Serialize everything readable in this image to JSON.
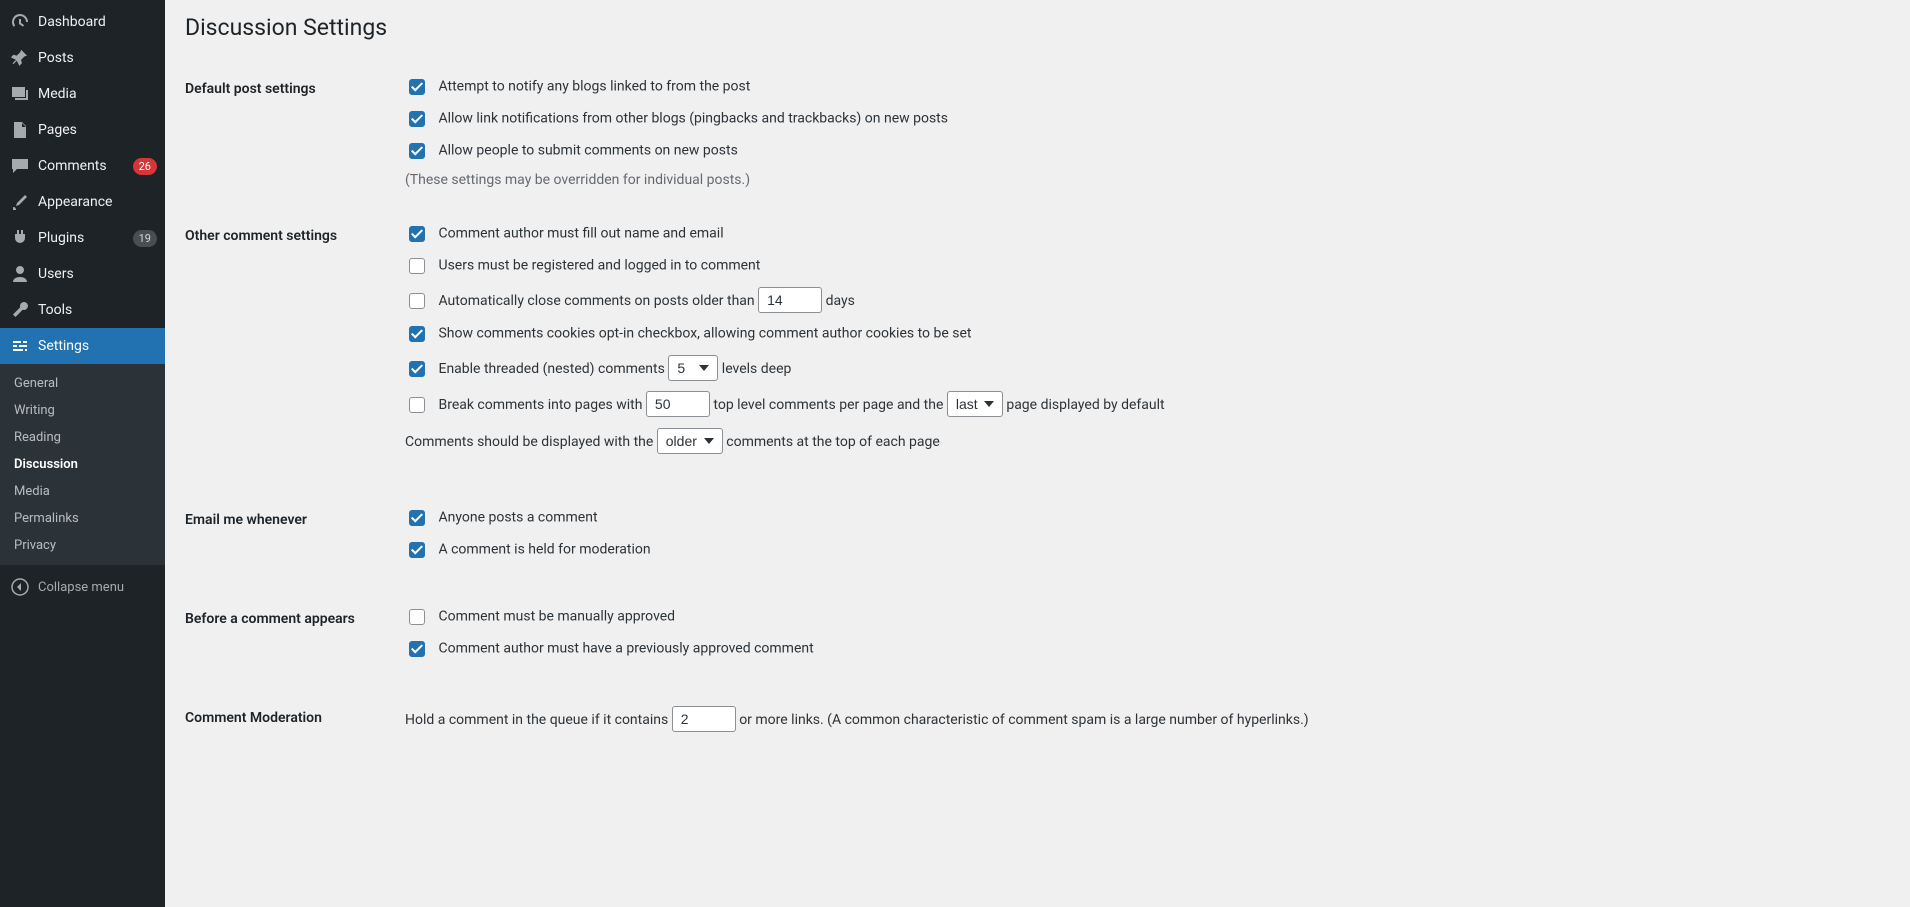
{
  "sidebar": {
    "items": [
      {
        "label": "Dashboard"
      },
      {
        "label": "Posts"
      },
      {
        "label": "Media"
      },
      {
        "label": "Pages"
      },
      {
        "label": "Comments",
        "badge": "26"
      },
      {
        "label": "Appearance"
      },
      {
        "label": "Plugins",
        "badge": "19"
      },
      {
        "label": "Users"
      },
      {
        "label": "Tools"
      },
      {
        "label": "Settings"
      }
    ],
    "submenu": [
      "General",
      "Writing",
      "Reading",
      "Discussion",
      "Media",
      "Permalinks",
      "Privacy"
    ],
    "collapse": "Collapse menu"
  },
  "page": {
    "title": "Discussion Settings"
  },
  "sections": {
    "default_post": {
      "heading": "Default post settings",
      "notify": "Attempt to notify any blogs linked to from the post",
      "pingback": "Allow link notifications from other blogs (pingbacks and trackbacks) on new posts",
      "allow_comments": "Allow people to submit comments on new posts",
      "note": "(These settings may be overridden for individual posts.)"
    },
    "other": {
      "heading": "Other comment settings",
      "fill_name": "Comment author must fill out name and email",
      "registered": "Users must be registered and logged in to comment",
      "auto_close_pre": "Automatically close comments on posts older than ",
      "auto_close_days_value": "14",
      "auto_close_post": " days",
      "opt_in": "Show comments cookies opt-in checkbox, allowing comment author cookies to be set",
      "threaded_pre": "Enable threaded (nested) comments ",
      "threaded_levels_value": "5",
      "threaded_post": " levels deep",
      "break_pre": "Break comments into pages with ",
      "break_value": "50",
      "break_mid1": " top level comments per page and the ",
      "break_page_value": "last",
      "break_post": " page displayed by default",
      "display_pre": "Comments should be displayed with the ",
      "display_order_value": "older",
      "display_post": " comments at the top of each page"
    },
    "email": {
      "heading": "Email me whenever",
      "anyone": "Anyone posts a comment",
      "held": "A comment is held for moderation"
    },
    "before": {
      "heading": "Before a comment appears",
      "manual": "Comment must be manually approved",
      "prev_approved": "Comment author must have a previously approved comment"
    },
    "moderation": {
      "heading": "Comment Moderation",
      "hold_pre": "Hold a comment in the queue if it contains ",
      "hold_value": "2",
      "hold_post": " or more links. (A common characteristic of comment spam is a large number of hyperlinks.)"
    }
  }
}
